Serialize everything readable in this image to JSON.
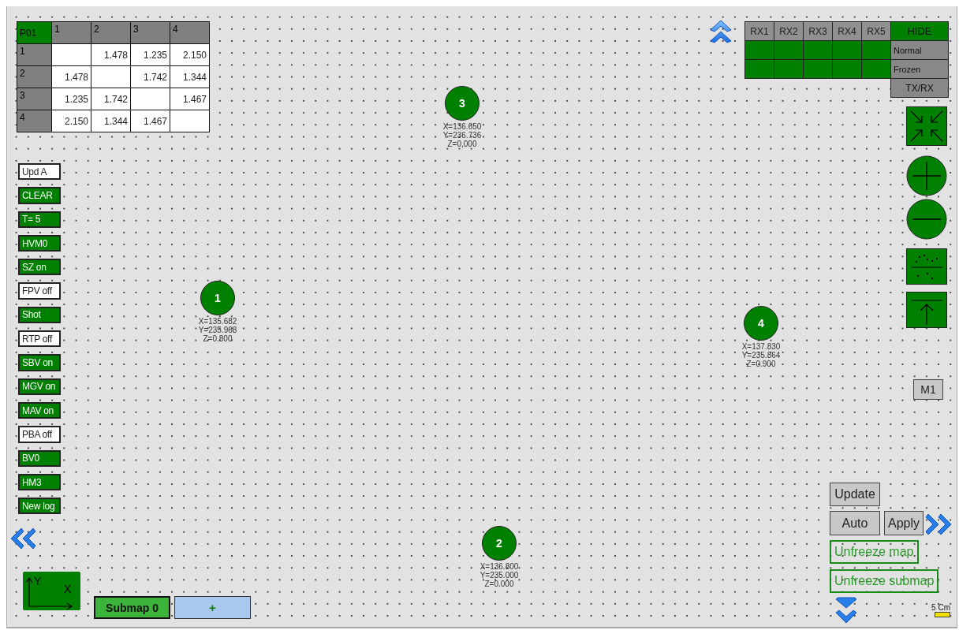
{
  "matrix": {
    "corner": "P01",
    "columns": [
      "1",
      "2",
      "3",
      "4"
    ],
    "rows": [
      {
        "label": "1",
        "cells": [
          null,
          "1.478",
          "1.235",
          "2.150"
        ]
      },
      {
        "label": "2",
        "cells": [
          "1.478",
          null,
          "1.742",
          "1.344"
        ]
      },
      {
        "label": "3",
        "cells": [
          "1.235",
          "1.742",
          null,
          "1.467"
        ]
      },
      {
        "label": "4",
        "cells": [
          "2.150",
          "1.344",
          "1.467",
          null
        ]
      }
    ]
  },
  "rx_panel": {
    "channels": [
      {
        "label": "RX1",
        "normal": true,
        "frozen": true
      },
      {
        "label": "RX2",
        "normal": true,
        "frozen": true
      },
      {
        "label": "RX3",
        "normal": true,
        "frozen": true
      },
      {
        "label": "RX4",
        "normal": true,
        "frozen": true
      },
      {
        "label": "RX5",
        "normal": true,
        "frozen": true
      }
    ],
    "hide": "HIDE",
    "row_labels": [
      "Normal",
      "Frozen"
    ],
    "txrx": "TX/RX"
  },
  "left_buttons": [
    {
      "label": "Upd A",
      "on": false
    },
    {
      "label": "CLEAR",
      "on": true
    },
    {
      "label": "T= 5",
      "on": true
    },
    {
      "label": "HVM0",
      "on": true
    },
    {
      "label": "SZ on",
      "on": true
    },
    {
      "label": "FPV off",
      "on": false
    },
    {
      "label": "Shot",
      "on": true
    },
    {
      "label": "RTP off",
      "on": false
    },
    {
      "label": "SBV on",
      "on": true
    },
    {
      "label": "MGV on",
      "on": true
    },
    {
      "label": "MAV on",
      "on": true
    },
    {
      "label": "PBA off",
      "on": false
    },
    {
      "label": "BV0",
      "on": true
    },
    {
      "label": "HM3",
      "on": true
    },
    {
      "label": "New log",
      "on": true
    }
  ],
  "nodes": [
    {
      "label": "1",
      "x": "X=135.682",
      "y": "Y=235.968",
      "z": "Z=0.800"
    },
    {
      "label": "3",
      "x": "X=136.650",
      "y": "Y=236.736",
      "z": "Z=0,000"
    },
    {
      "label": "4",
      "x": "X=137.830",
      "y": "Y=235.864",
      "z": "Z=0.900"
    },
    {
      "label": "2",
      "x": "X=136.800",
      "y": "Y=235.000",
      "z": "Z=0.000"
    }
  ],
  "m1": "M1",
  "update": "Update",
  "auto": "Auto",
  "apply": "Apply",
  "unfreeze_map": "Unfreeze map",
  "unfreeze_submap": "Unfreeze submap",
  "scale": "5 Cm",
  "axis": {
    "y": "Y",
    "x": "X"
  },
  "submaps": [
    {
      "label": "Submap 0",
      "selected": true
    }
  ],
  "add_submap": "+"
}
